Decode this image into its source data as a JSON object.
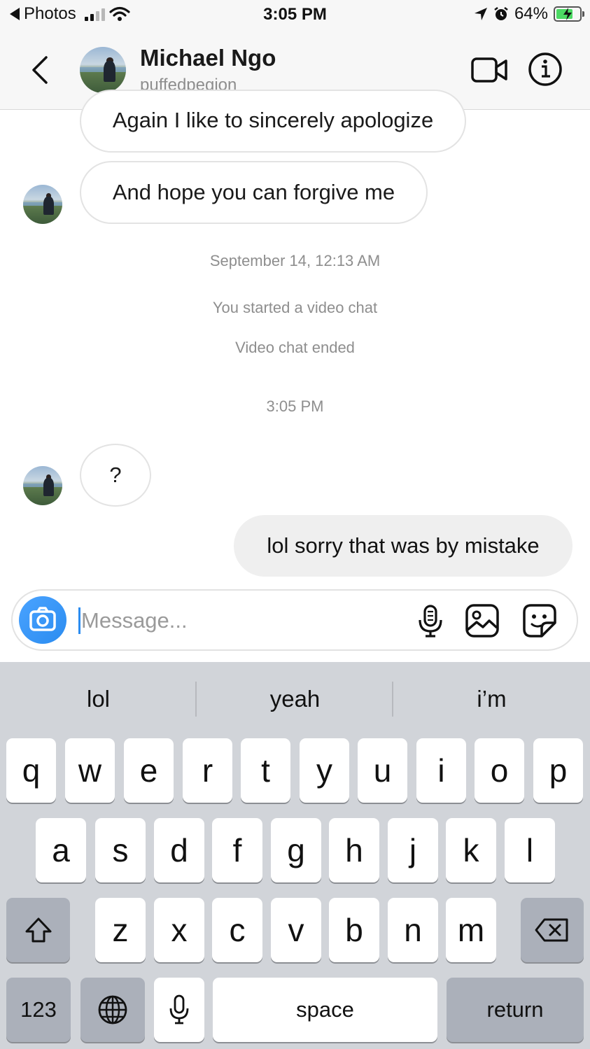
{
  "status_bar": {
    "back_app": "Photos",
    "time": "3:05 PM",
    "battery": "64%",
    "battery_level": 0.64
  },
  "header": {
    "name": "Michael Ngo",
    "username": "puffedpegion"
  },
  "messages": {
    "received_1": "Again I like to sincerely apologize",
    "received_2": "And hope you can forgive me",
    "timestamp_1": "September 14, 12:13 AM",
    "system_1": "You started a video chat",
    "system_2": "Video chat ended",
    "timestamp_2": "3:05 PM",
    "received_3": "?",
    "sent_1": "lol sorry that was by mistake"
  },
  "composer": {
    "placeholder": "Message..."
  },
  "keyboard": {
    "suggestions": [
      "lol",
      "yeah",
      "i’m"
    ],
    "row1": [
      "q",
      "w",
      "e",
      "r",
      "t",
      "y",
      "u",
      "i",
      "o",
      "p"
    ],
    "row2": [
      "a",
      "s",
      "d",
      "f",
      "g",
      "h",
      "j",
      "k",
      "l"
    ],
    "row3": [
      "z",
      "x",
      "c",
      "v",
      "b",
      "n",
      "m"
    ],
    "numbers_key": "123",
    "space_key": "space",
    "return_key": "return"
  },
  "colors": {
    "accent": "#2b8cf0",
    "battery_green": "#4cd964",
    "keyboard_bg": "#d1d4d9"
  }
}
